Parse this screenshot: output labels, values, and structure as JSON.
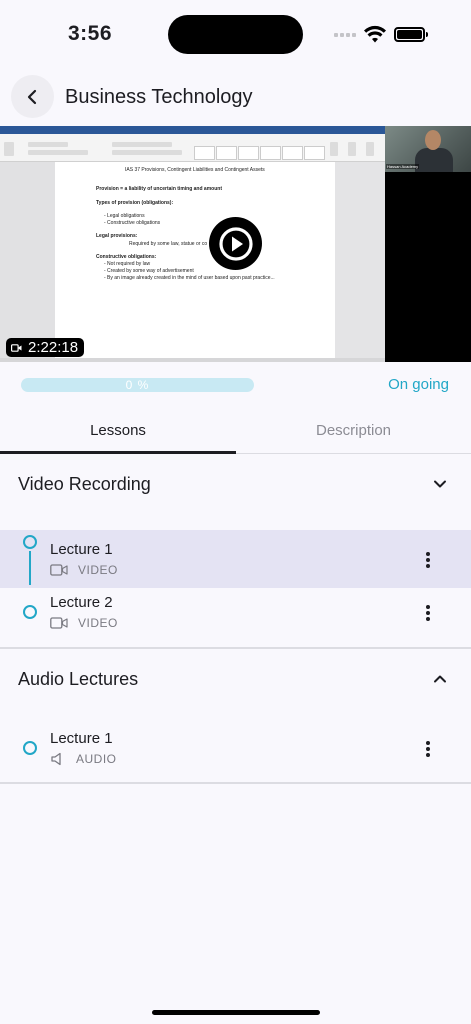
{
  "status_bar": {
    "time": "3:56"
  },
  "header": {
    "title": "Business Technology",
    "back_icon": "chevron-left-icon"
  },
  "video": {
    "duration": "2:22:18",
    "play_icon": "play-icon",
    "document": {
      "title_line": "IAS 37 Provisions, Contingent Liabilities and Contingent Assets",
      "lines": [
        "Provision = a liability of uncertain timing and amount",
        "Types of provision (obligations):",
        "-    Legal obligations",
        "-    Constructive obligations",
        "Legal provisions:",
        "Required by some law, statue or co",
        "Constructive obligations:",
        "-    Not required by law",
        "-    Created by some way of advertisement",
        "-    By an image already created in the mind of user based upon past practice..."
      ]
    },
    "presenter_name": "Hassan Academy"
  },
  "progress": {
    "percent": 0,
    "label": "0 %",
    "status": "On going",
    "color": "#22a7c7"
  },
  "tabs": [
    {
      "label": "Lessons",
      "active": true
    },
    {
      "label": "Description",
      "active": false
    }
  ],
  "sections": [
    {
      "title": "Video Recording",
      "expanded": true,
      "lessons": [
        {
          "title": "Lecture 1",
          "type": "VIDEO",
          "icon": "video-camera-icon",
          "selected": true
        },
        {
          "title": "Lecture 2",
          "type": "VIDEO",
          "icon": "video-camera-icon",
          "selected": false
        }
      ]
    },
    {
      "title": "Audio Lectures",
      "expanded": false,
      "lessons": [
        {
          "title": "Lecture 1",
          "type": "AUDIO",
          "icon": "speaker-icon",
          "selected": false
        }
      ]
    }
  ]
}
